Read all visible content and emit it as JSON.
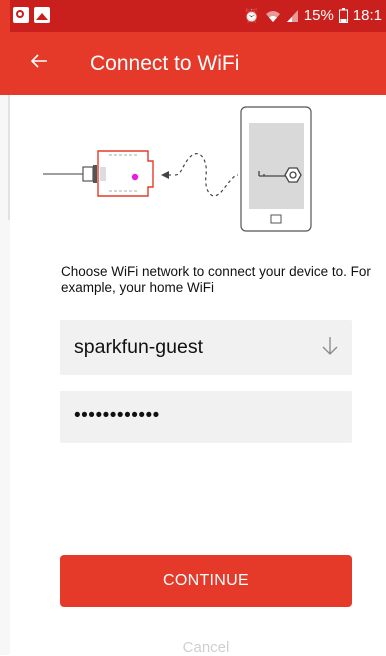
{
  "status_bar": {
    "battery_percent": "15%",
    "time": "18:1",
    "icons": [
      "app-p-icon",
      "image-icon",
      "alarm-icon",
      "wifi-icon",
      "signal-icon",
      "battery-icon"
    ]
  },
  "toolbar": {
    "back_icon": "arrow-left-icon",
    "title": "Connect to WiFi"
  },
  "illustration": {
    "icons": [
      "device-board-icon",
      "arrow-left-icon",
      "phone-icon",
      "key-icon"
    ]
  },
  "form": {
    "prompt": "Choose WiFi network to connect your device to. For example, your home WiFi",
    "ssid_value": "sparkfun-guest",
    "dropdown_icon": "arrow-down-icon",
    "password_value": "••••••••••••"
  },
  "actions": {
    "continue_label": "CONTINUE",
    "cancel_label": "Cancel"
  },
  "colors": {
    "status_bar": "#c9201d",
    "toolbar": "#e53a2a",
    "accent": "#e53a2a",
    "field_bg": "#f1f1f1",
    "cancel_text": "#cfcfcf",
    "magenta_dot": "#e31ee0"
  }
}
